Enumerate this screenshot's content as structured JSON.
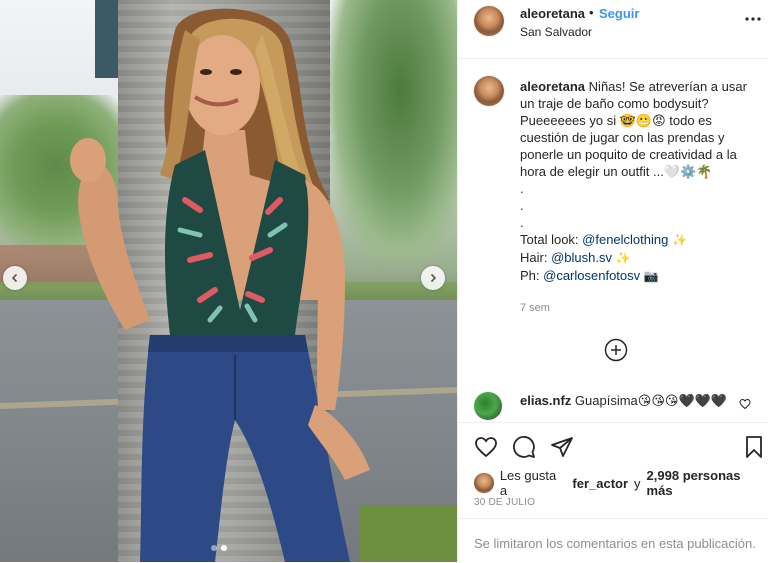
{
  "post": {
    "username": "aleoretana",
    "separator": "•",
    "follow_label": "Seguir",
    "location": "San Salvador"
  },
  "caption": {
    "username": "aleoretana",
    "line1": "Niñas! Se atreverían a usar un traje de baño como bodysuit? Pueeeeees yo si 🤓😬😡 todo es cuestión de jugar con las prendas y ponerle un poquito de creatividad a la hora de elegir un outfit ...🤍⚙️🌴",
    "dot1": ".",
    "dot2": ".",
    "dot3": ".",
    "total_look_label": "Total look: ",
    "total_look_mention": "@fenelclothing",
    "total_look_emoji": "✨",
    "hair_label": "Hair: ",
    "hair_mention": "@blush.sv",
    "hair_emoji": "✨",
    "ph_label": "Ph: ",
    "ph_mention": "@carlosenfotosv",
    "ph_emoji": "📷",
    "time_ago": "7 sem"
  },
  "comment": {
    "username": "elias.nfz",
    "text": "Guapísima😘😘😘🖤🖤🖤"
  },
  "likes": {
    "prefix": "Les gusta a",
    "user": "fer_actor",
    "middle": "y",
    "count": "2,998 personas más"
  },
  "date": "30 DE JULIO",
  "footer_text": "Se limitaron los comentarios en esta publicación.",
  "carousel": {
    "current_index": 2,
    "total": 2
  },
  "icons": {
    "more": "more-horizontal-icon",
    "add": "plus-circle-icon",
    "like": "heart-icon",
    "comment": "comment-bubble-icon",
    "share": "paper-plane-icon",
    "save": "bookmark-icon",
    "prev": "chevron-left-icon",
    "next": "chevron-right-icon"
  },
  "colors": {
    "link": "#3897f0",
    "mention": "#00376b",
    "muted": "#8e8e8e",
    "text": "#262626"
  }
}
